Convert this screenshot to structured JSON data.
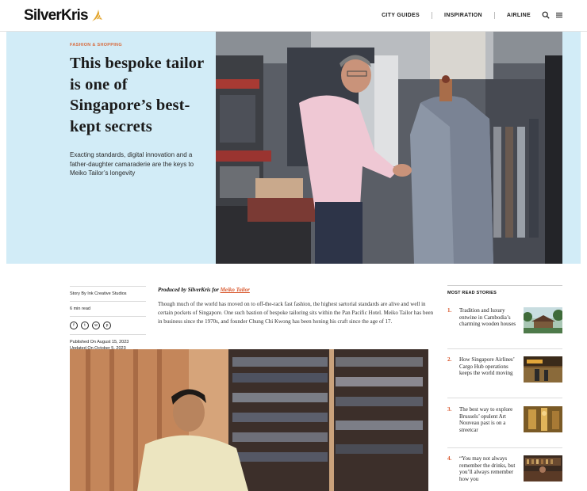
{
  "header": {
    "logo": "SilverKris",
    "nav": [
      "CITY GUIDES",
      "INSPIRATION",
      "AIRLINE"
    ],
    "icons": [
      "search-icon",
      "menu-icon"
    ]
  },
  "hero": {
    "category": "FASHION & SHOPPING",
    "title": "This bespoke tailor is one of Singapore’s best-kept secrets",
    "subtitle": "Exacting standards, digital innovation and a father-daughter camaraderie are the keys to Meiko Tailor’s longevity",
    "background_color": "#d2ecf7"
  },
  "meta": {
    "story_by": "Story By Ink Creative Studios",
    "read_time": "6 min read",
    "social_icons": [
      "facebook-icon",
      "twitter-icon",
      "whatsapp-icon",
      "pinterest-icon"
    ],
    "published": "Published On August 15, 2023",
    "updated": "Updated On October 5, 2023"
  },
  "article": {
    "produced_prefix": "Produced by SilverKris for ",
    "produced_link": "Meiko Tailor",
    "body": "Though much of the world has moved on to off-the-rack fast fashion, the highest sartorial standards are alive and well in certain pockets of Singapore. One such bastion of bespoke tailoring sits within the Pan Pacific Hotel. Meiko Tailor has been in business since the 1970s, and founder Chung Chi Kwong has been honing his craft since the age of 17."
  },
  "most_read": {
    "heading": "MOST READ STORIES",
    "accent_color": "#d8552a",
    "items": [
      {
        "num": "1.",
        "title": "Tradition and luxury entwine in Cambodia’s charming wooden houses"
      },
      {
        "num": "2.",
        "title": "How Singapore Airlines’ Cargo Hub operations keeps the world moving"
      },
      {
        "num": "3.",
        "title": "The best way to explore Brussels’ opulent Art Nouveau past is on a streetcar"
      },
      {
        "num": "4.",
        "title": "“You may not always remember the drinks, but you’ll always remember how you"
      }
    ]
  }
}
